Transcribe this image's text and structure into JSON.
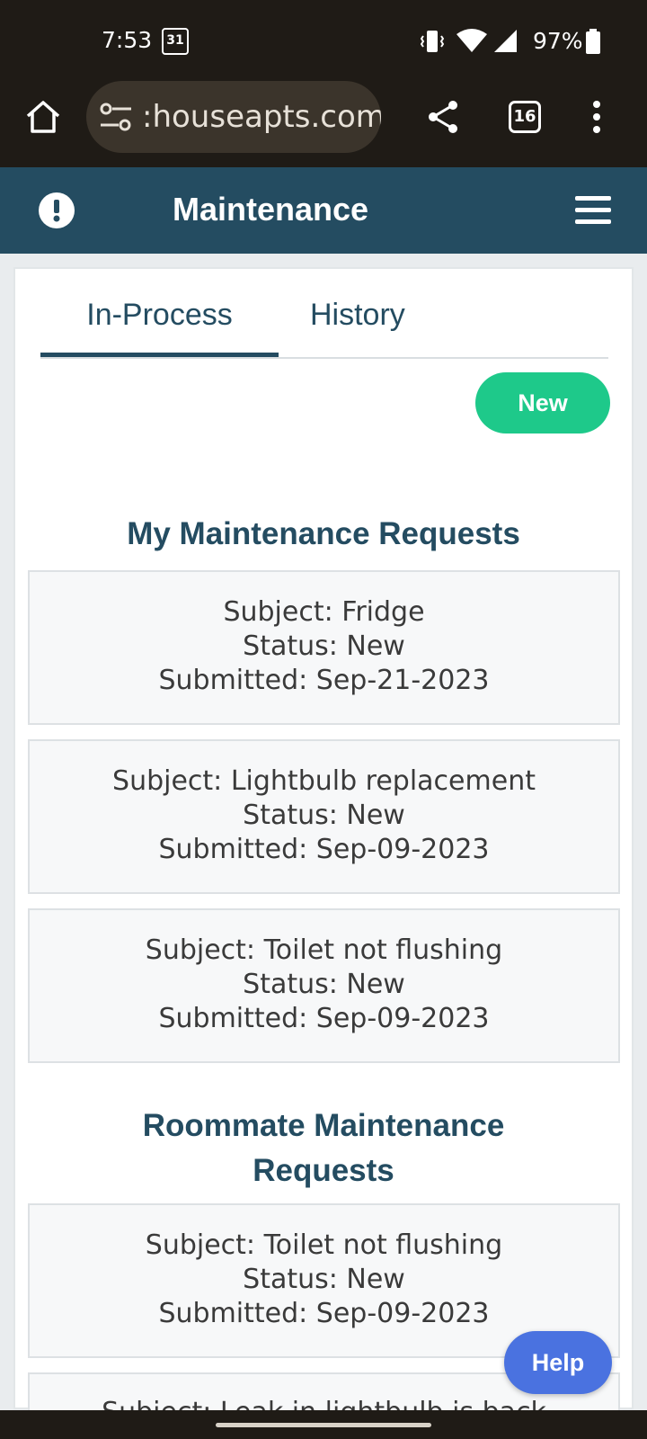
{
  "status_bar": {
    "time": "7:53",
    "calendar_day": "31",
    "battery": "97%"
  },
  "browser": {
    "url": ":houseapts.com",
    "tab_count": "16"
  },
  "app_header": {
    "title": "Maintenance"
  },
  "tabs": [
    {
      "label": "In-Process",
      "active": true
    },
    {
      "label": "History",
      "active": false
    }
  ],
  "new_button": "New",
  "my_requests": {
    "title": "My Maintenance Requests",
    "items": [
      {
        "subject": "Subject: Fridge",
        "status": "Status: New",
        "submitted": "Submitted: Sep-21-2023"
      },
      {
        "subject": "Subject: Lightbulb replacement",
        "status": "Status: New",
        "submitted": "Submitted: Sep-09-2023"
      },
      {
        "subject": "Subject: Toilet not flushing",
        "status": "Status: New",
        "submitted": "Submitted: Sep-09-2023"
      }
    ]
  },
  "roommate_requests": {
    "title": "Roommate Maintenance Requests",
    "items": [
      {
        "subject": "Subject: Toilet not flushing",
        "status": "Status: New",
        "submitted": "Submitted: Sep-09-2023"
      },
      {
        "subject": "Subject: Leak in lightbulb is back",
        "status": "",
        "submitted": ""
      }
    ]
  },
  "help_button": "Help",
  "colors": {
    "header": "#244c61",
    "accent_new": "#1ec98a",
    "help": "#4a72e0"
  }
}
